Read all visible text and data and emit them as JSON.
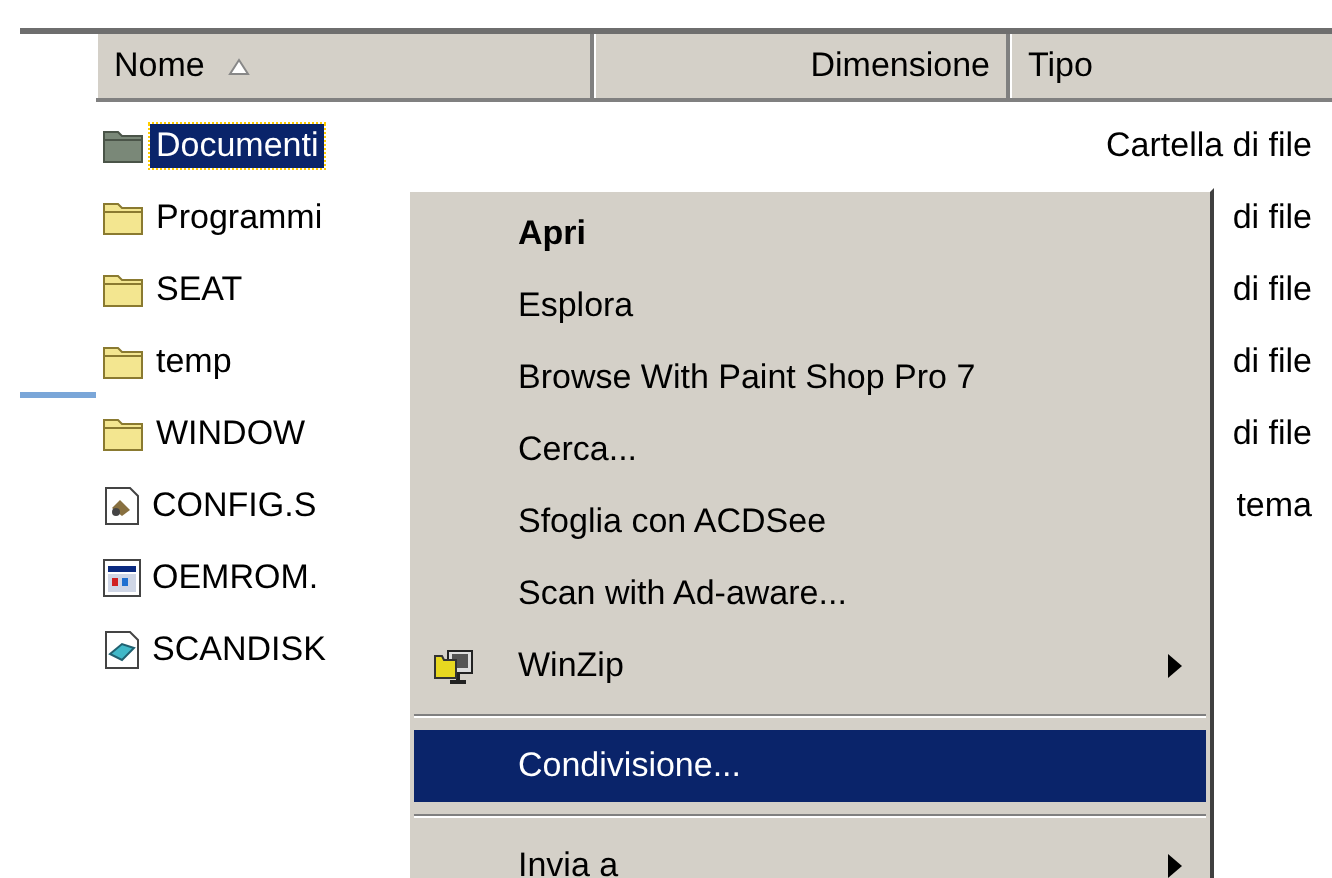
{
  "columns": [
    {
      "label": "Nome",
      "sorted": true
    },
    {
      "label": "Dimensione",
      "sorted": false
    },
    {
      "label": "Tipo",
      "sorted": false
    }
  ],
  "rows": [
    {
      "name": "Documenti",
      "kind": "folder",
      "type": "Cartella di file",
      "selected": true
    },
    {
      "name": "Programmi",
      "kind": "folder",
      "type": "di file",
      "selected": false
    },
    {
      "name": "SEAT",
      "kind": "folder",
      "type": "di file",
      "selected": false
    },
    {
      "name": "temp",
      "kind": "folder",
      "type": "di file",
      "selected": false
    },
    {
      "name": "WINDOW",
      "kind": "folder",
      "type": "di file",
      "selected": false
    },
    {
      "name": "CONFIG.S",
      "kind": "settings",
      "type": "tema",
      "selected": false
    },
    {
      "name": "OEMROM.",
      "kind": "program",
      "selected": false
    },
    {
      "name": "SCANDISK",
      "kind": "shortcut",
      "selected": false
    }
  ],
  "context_menu": [
    {
      "kind": "default",
      "label": "Apri",
      "selected": false
    },
    {
      "kind": "item",
      "label": "Esplora",
      "selected": false
    },
    {
      "kind": "item",
      "label": "Browse With Paint Shop Pro 7",
      "selected": false
    },
    {
      "kind": "item",
      "label": "Cerca...",
      "selected": false
    },
    {
      "kind": "item",
      "label": "Sfoglia con ACDSee",
      "selected": false
    },
    {
      "kind": "item",
      "label": "Scan with Ad-aware...",
      "selected": false
    },
    {
      "kind": "app_submenu",
      "label": "WinZip",
      "selected": false
    },
    {
      "kind": "separator"
    },
    {
      "kind": "item",
      "label": "Condivisione...",
      "selected": true
    },
    {
      "kind": "separator"
    },
    {
      "kind": "submenu",
      "label": "Invia a",
      "selected": false
    }
  ]
}
